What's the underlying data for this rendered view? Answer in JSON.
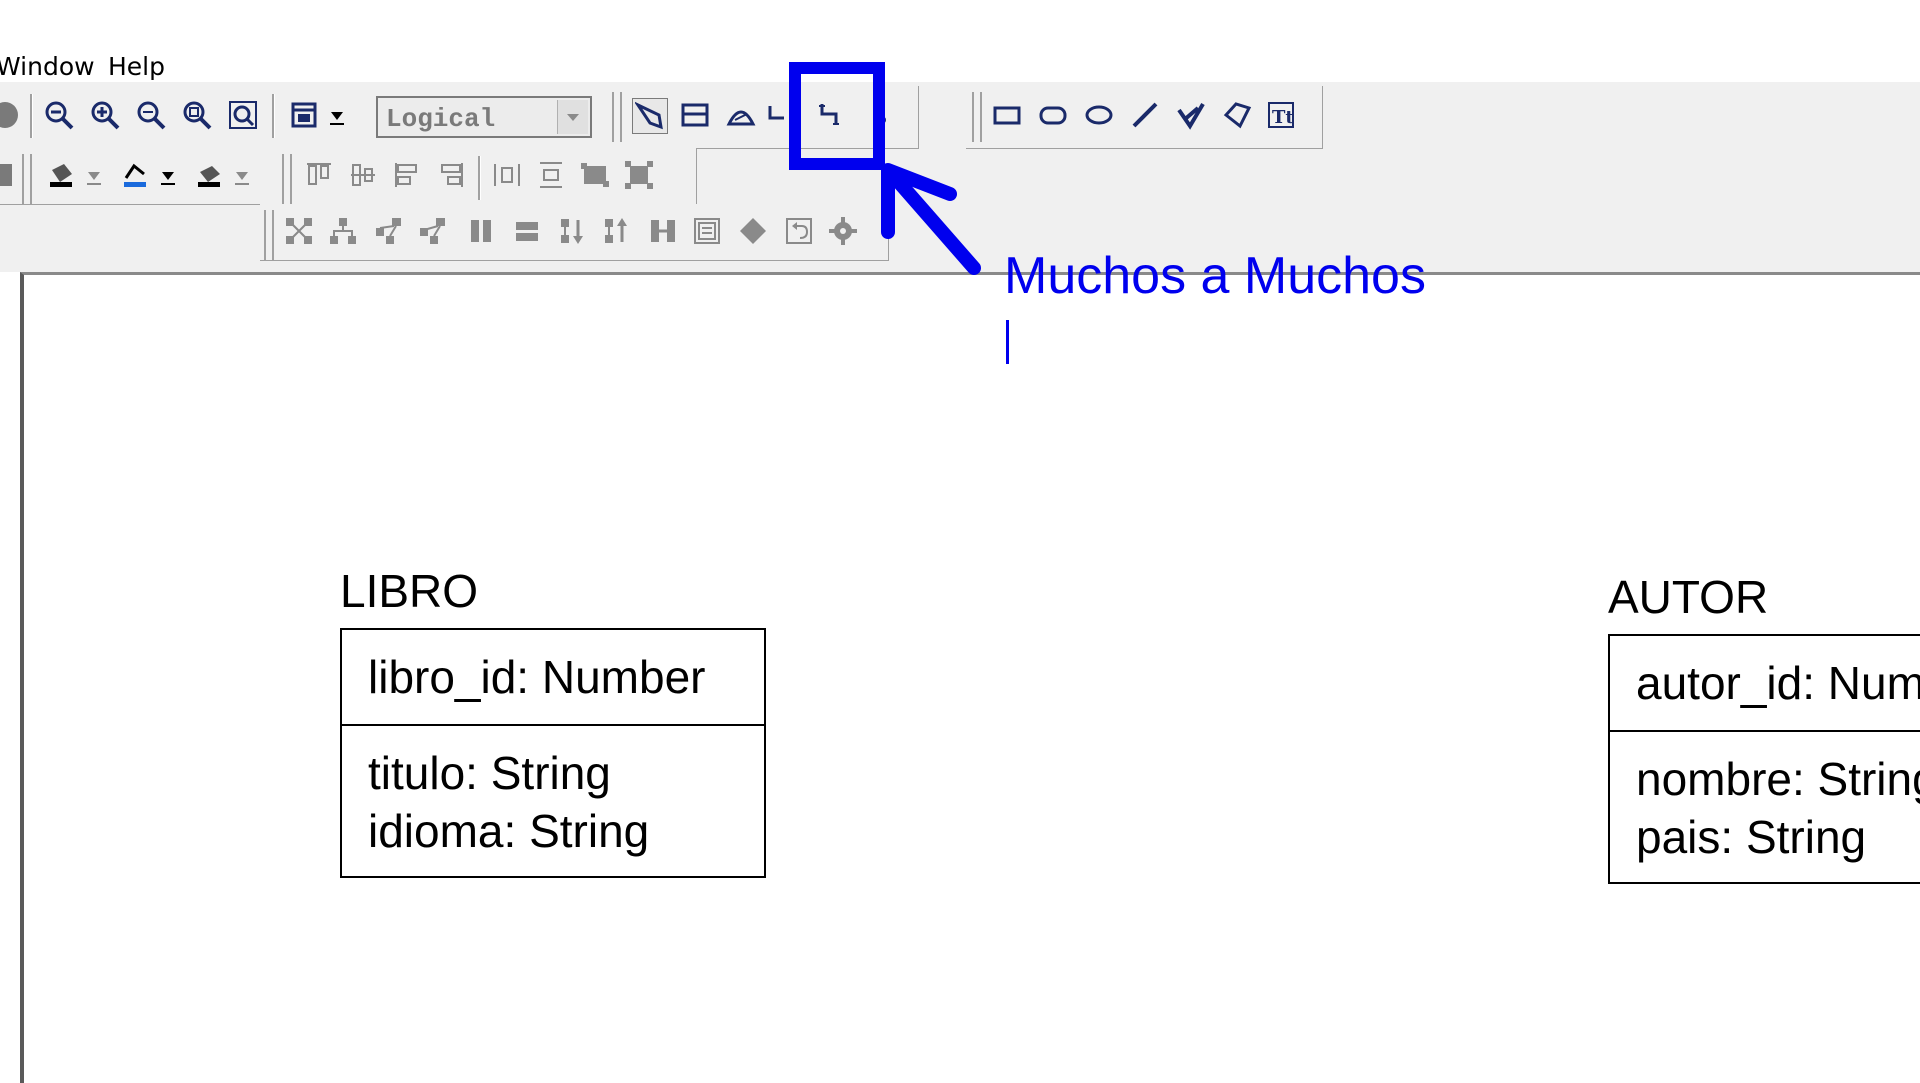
{
  "menubar": {
    "items": [
      {
        "label": "Window",
        "mnemonic": "W"
      },
      {
        "label": "Help",
        "mnemonic": "H"
      }
    ]
  },
  "toolbar": {
    "model_combo": {
      "selected": "Logical"
    },
    "highlighted_tool": "many-to-many-relationship-tool"
  },
  "annotation": {
    "label": "Muchos a Muchos",
    "color": "#0000ee"
  },
  "diagram": {
    "entities": [
      {
        "name": "LIBRO",
        "key_attributes": [
          "libro_id: Number"
        ],
        "attributes": [
          "titulo: String",
          "idioma: String"
        ]
      },
      {
        "name": "AUTOR",
        "key_attributes": [
          "autor_id: Number"
        ],
        "attributes": [
          "nombre: String",
          "pais: String"
        ]
      }
    ]
  }
}
